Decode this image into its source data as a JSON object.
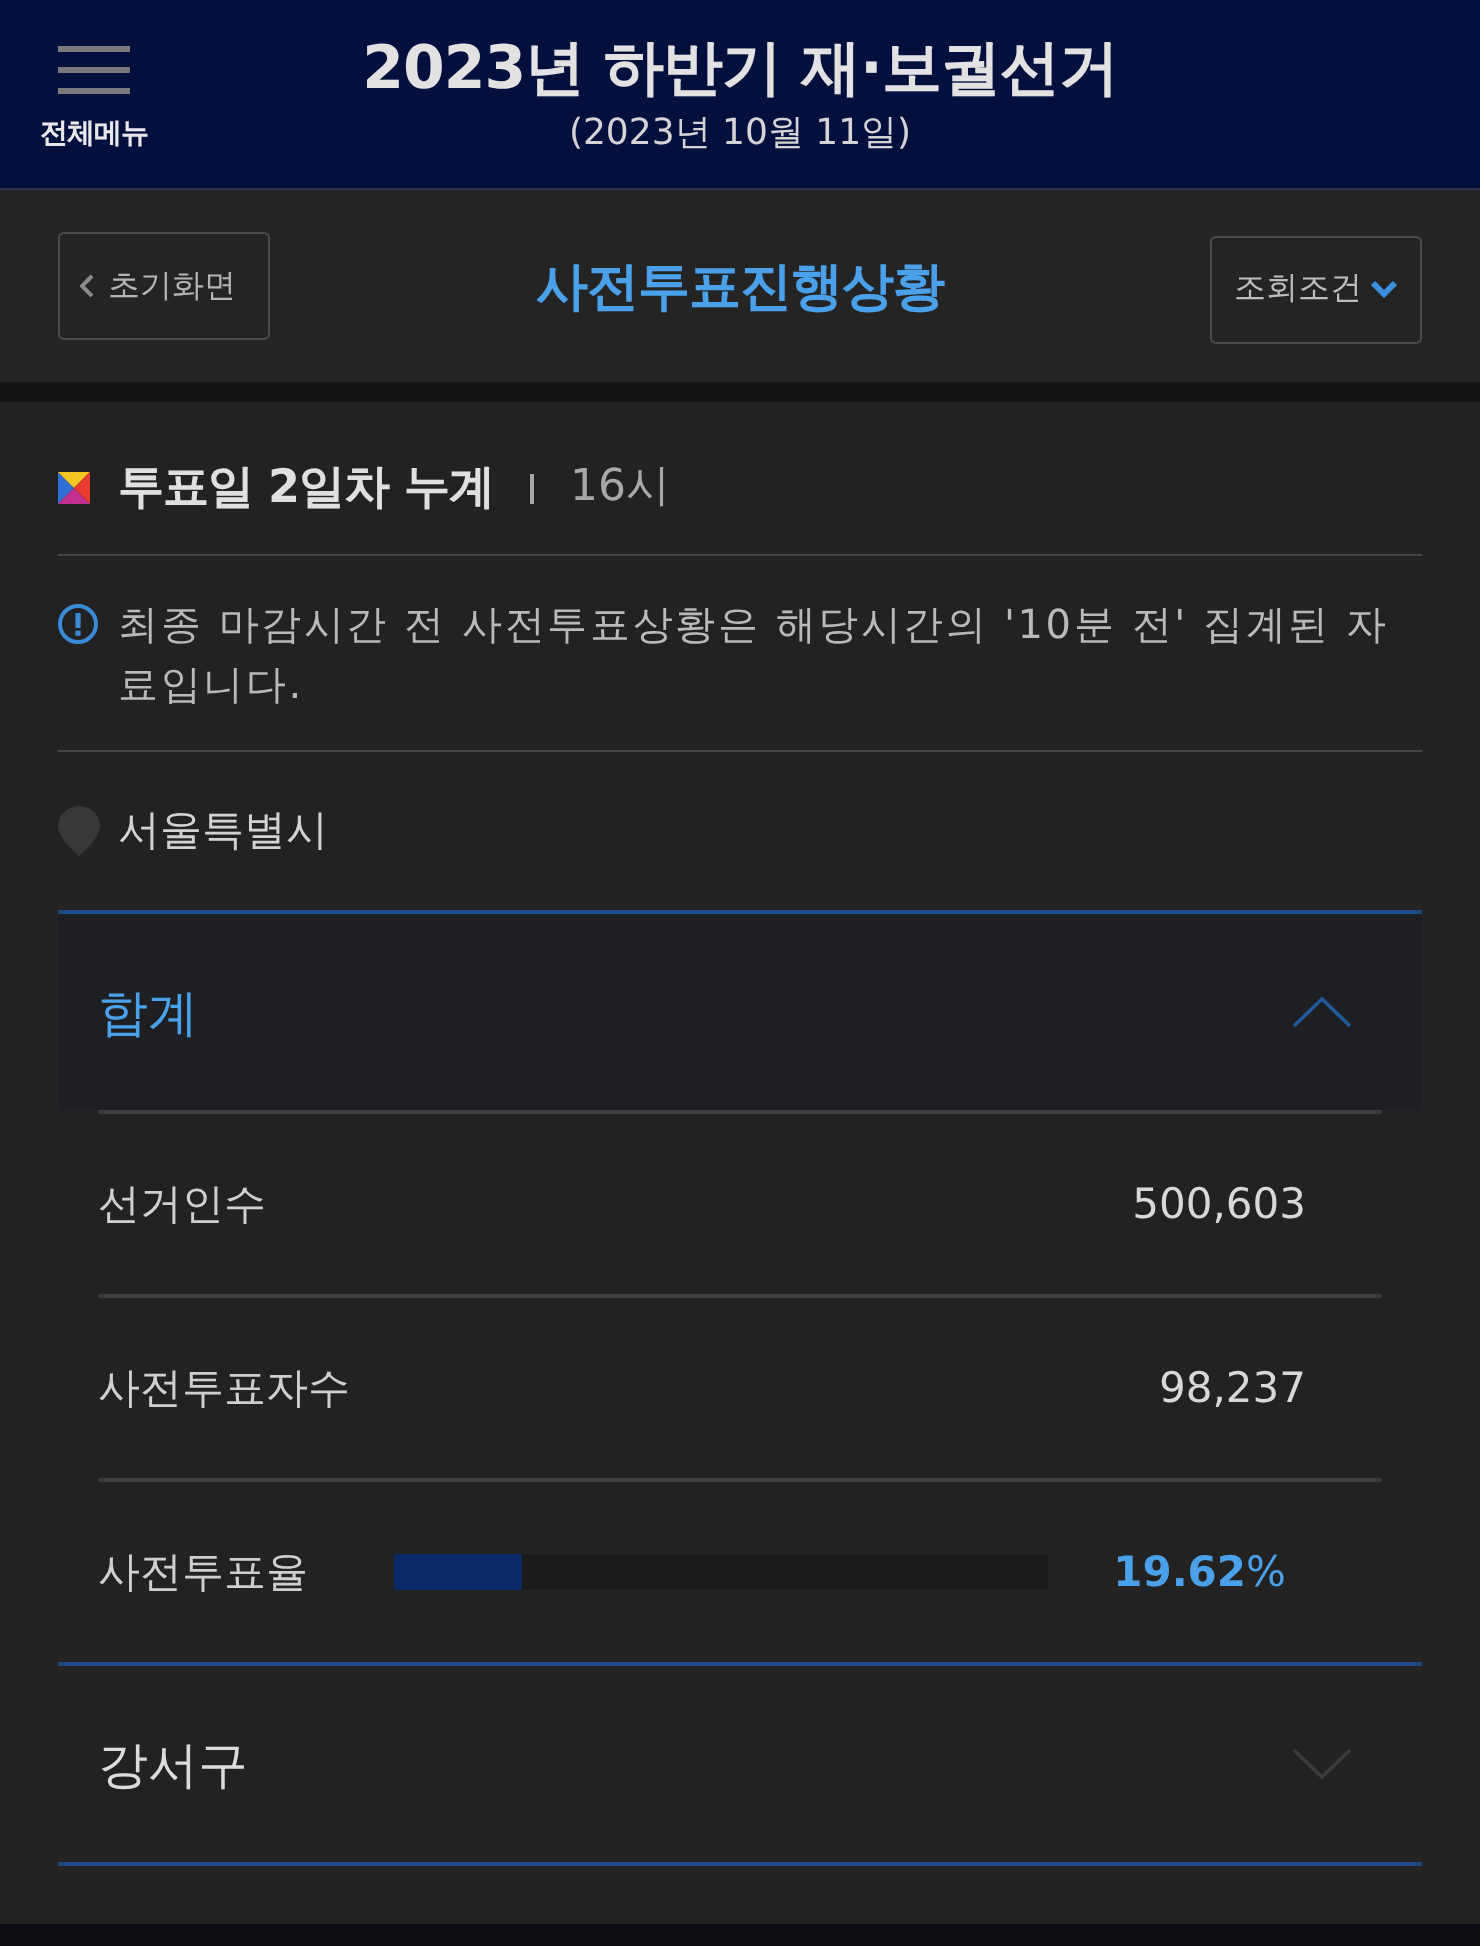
{
  "header": {
    "menu_label": "전체메뉴",
    "title": "2023년 하반기 재·보궐선거",
    "subtitle": "(2023년 10월 11일)"
  },
  "toolbar": {
    "back_button": "초기화면",
    "title": "사전투표진행상황",
    "filter_button": "조회조건"
  },
  "section": {
    "title": "투표일 2일차 누계",
    "time": "16시"
  },
  "notice": "최종 마감시간 전 사전투표상황은 해당시간의 '10분 전' 집계된 자료입니다.",
  "location": "서울특별시",
  "regions": [
    {
      "name": "합계",
      "expanded": true,
      "stats": [
        {
          "kind": "count",
          "label": "선거인수",
          "value": "500,603"
        },
        {
          "kind": "count",
          "label": "사전투표자수",
          "value": "98,237"
        },
        {
          "kind": "rate",
          "label": "사전투표율",
          "level": 0.1962,
          "value": "**19.62**%"
        }
      ]
    },
    {
      "name": "강서구",
      "expanded": false
    }
  ]
}
